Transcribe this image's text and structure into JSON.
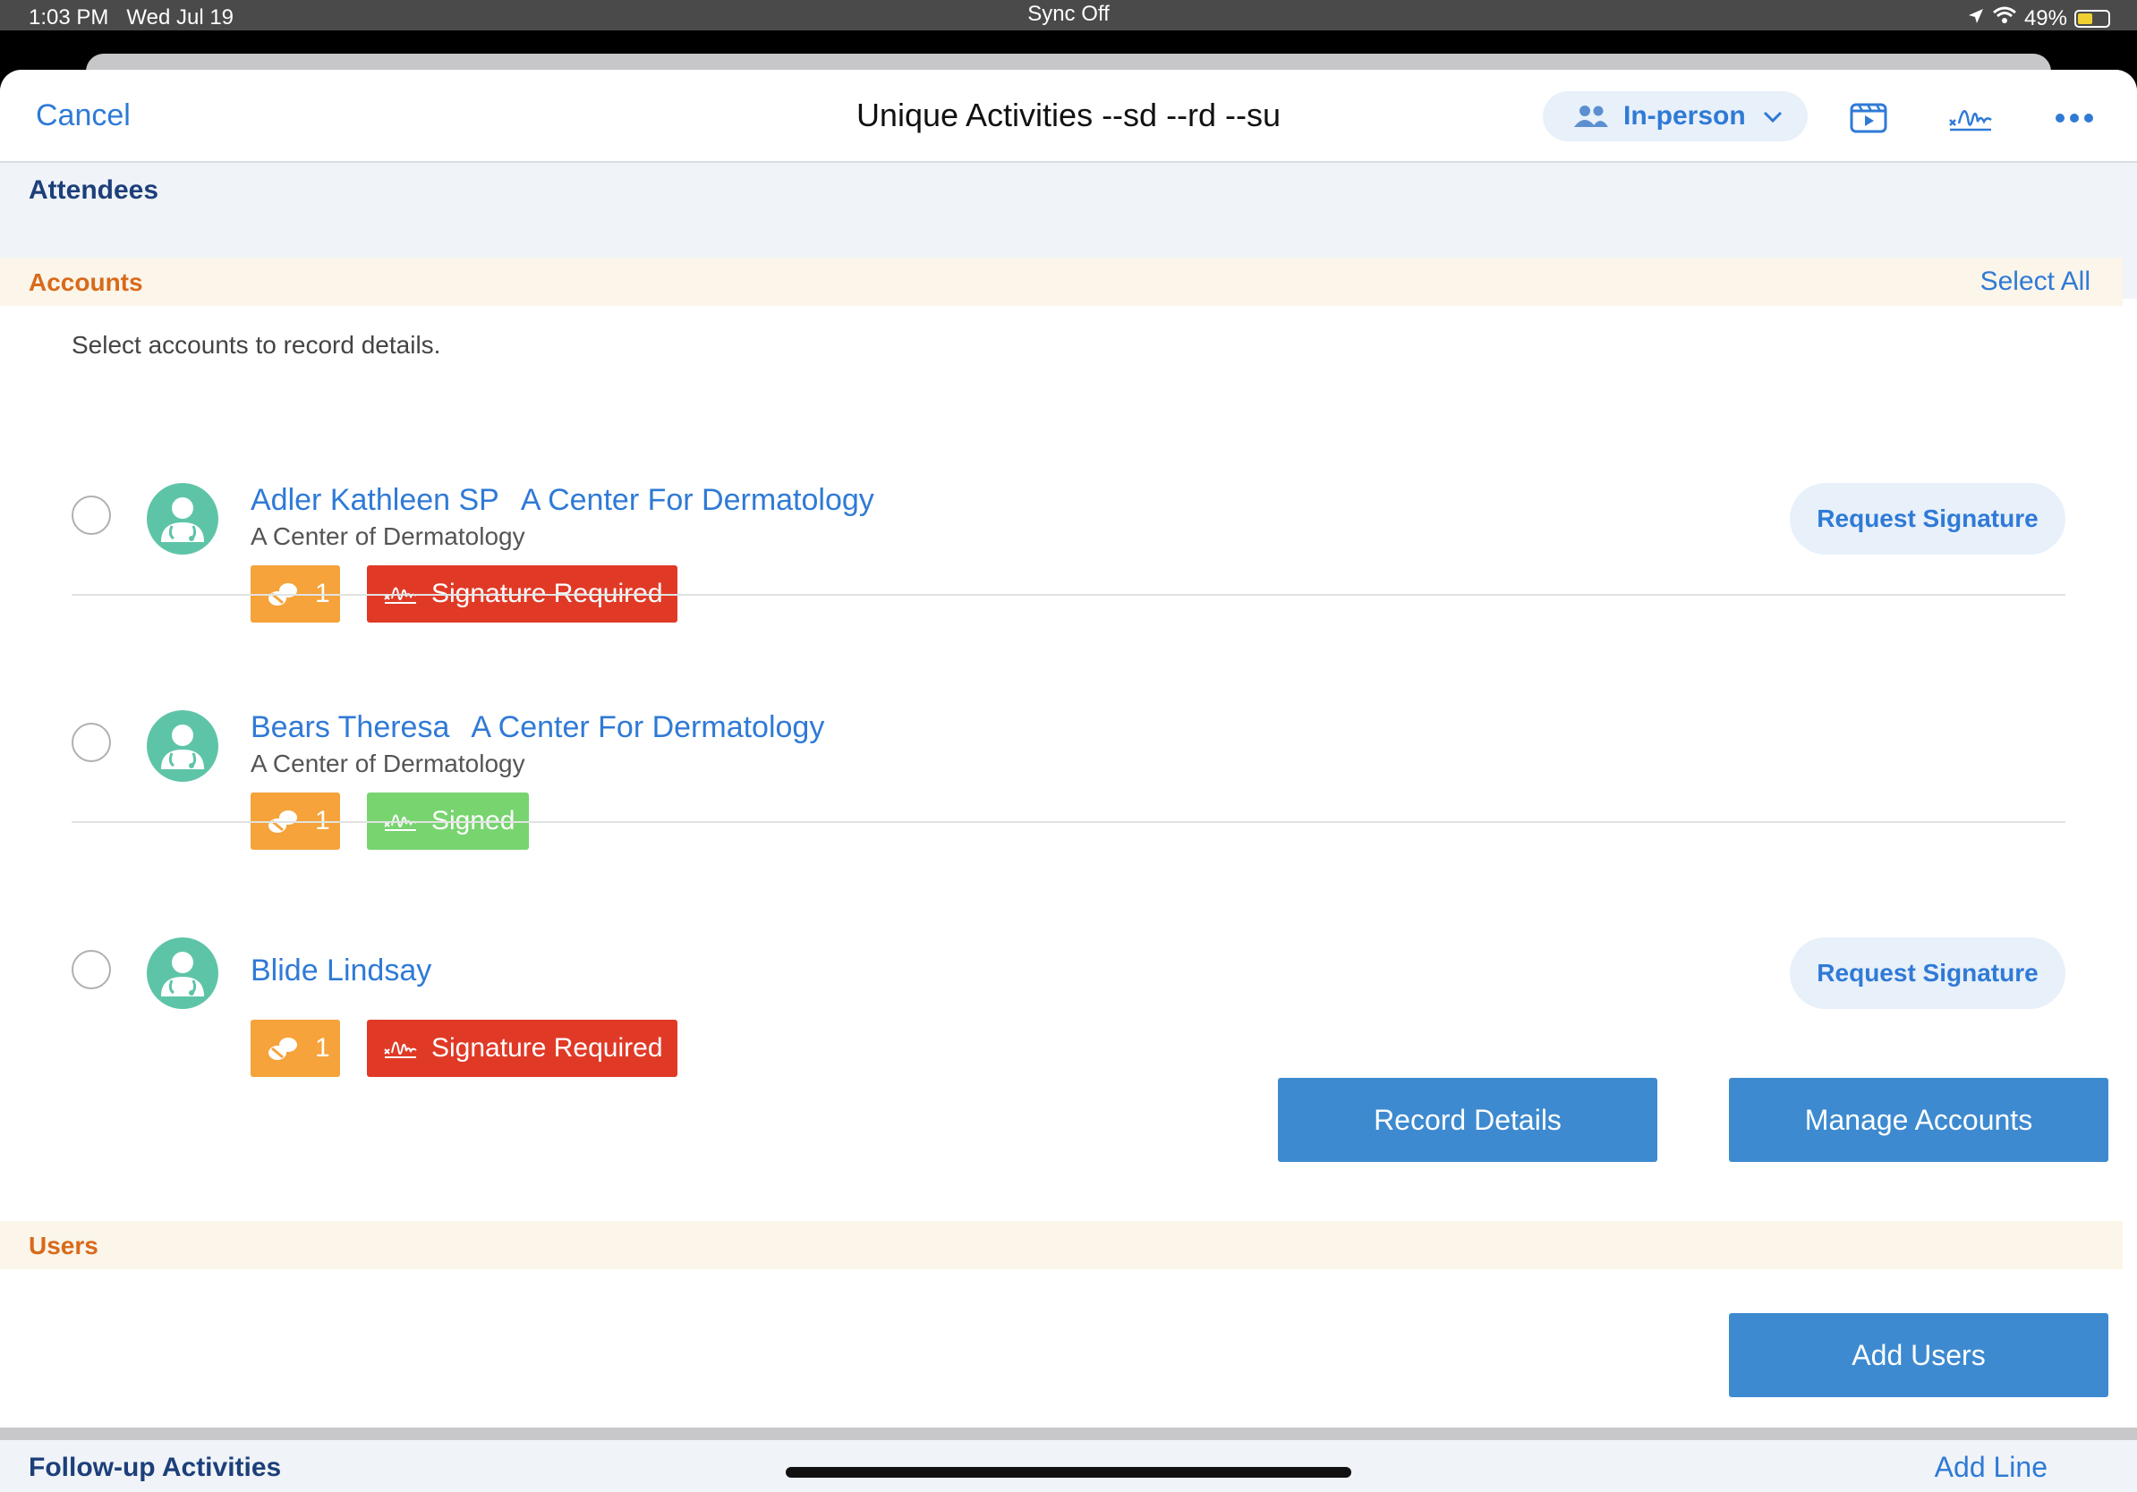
{
  "status_bar": {
    "time": "1:03 PM",
    "date": "Wed Jul 19",
    "sync": "Sync Off",
    "battery": "49%"
  },
  "nav": {
    "cancel": "Cancel",
    "title": "Unique Activities --sd --rd --su",
    "mode": "In-person",
    "icons": [
      "media-icon",
      "signature-icon",
      "more-icon"
    ]
  },
  "attendees": {
    "title": "Attendees"
  },
  "accounts": {
    "title": "Accounts",
    "select_all": "Select All",
    "hint": "Select accounts to record details.",
    "items": [
      {
        "name": "Adler Kathleen SP",
        "org_link": "A Center For Dermatology",
        "org": "A Center of Dermatology",
        "count": "1",
        "signature_status": "Signature Required",
        "signature_color": "#e03a27",
        "action": "Request Signature"
      },
      {
        "name": "Bears Theresa",
        "org_link": "A Center For Dermatology",
        "org": "A Center of Dermatology",
        "count": "1",
        "signature_status": "Signed",
        "signature_color": "#77d46f",
        "action": ""
      },
      {
        "name": "Blide Lindsay",
        "org_link": "",
        "org": "",
        "count": "1",
        "signature_status": "Signature Required",
        "signature_color": "#e03a27",
        "action": "Request Signature"
      }
    ],
    "record_details": "Record Details",
    "manage_accounts": "Manage Accounts"
  },
  "users": {
    "title": "Users",
    "add_users": "Add Users"
  },
  "followup": {
    "title": "Follow-up Activities",
    "add_line": "Add Line"
  },
  "colors": {
    "accent": "#2f7ad6",
    "primary_button": "#3d8ad0",
    "group_title": "#d86a1a",
    "count_badge": "#f5a33a"
  }
}
